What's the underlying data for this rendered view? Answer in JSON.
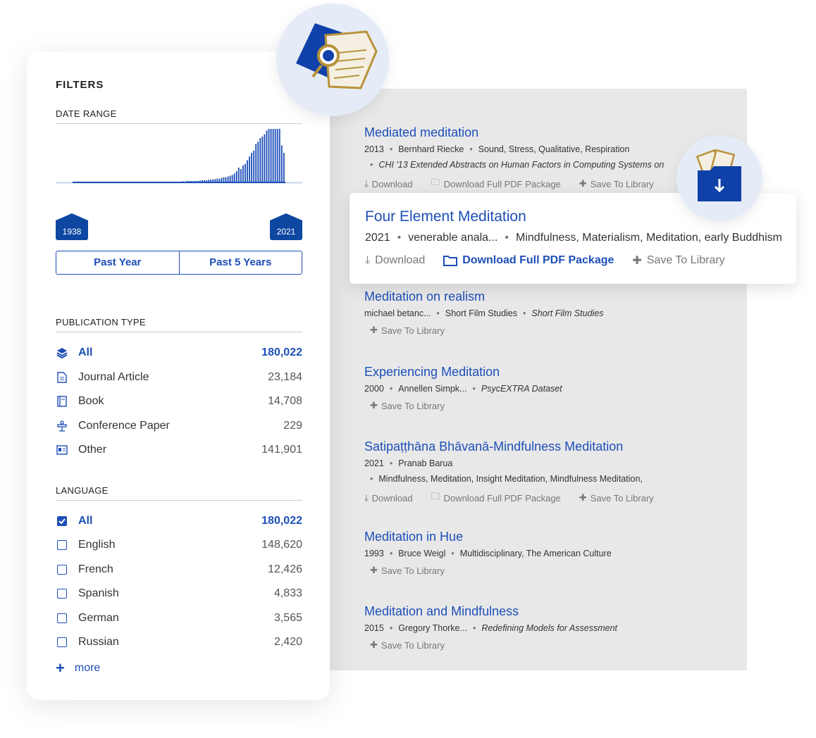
{
  "filters": {
    "heading": "FILTERS",
    "date_range": {
      "label": "DATE RANGE",
      "start_year": "1938",
      "end_year": "2021",
      "past_year": "Past Year",
      "past_5_years": "Past 5 Years"
    },
    "publication_type": {
      "label": "PUBLICATION TYPE",
      "items": [
        {
          "label": "All",
          "count": "180,022",
          "icon": "layers-icon",
          "active": true
        },
        {
          "label": "Journal Article",
          "count": "23,184",
          "icon": "document-icon"
        },
        {
          "label": "Book",
          "count": "14,708",
          "icon": "book-icon"
        },
        {
          "label": "Conference Paper",
          "count": "229",
          "icon": "podium-icon"
        },
        {
          "label": "Other",
          "count": "141,901",
          "icon": "newspaper-icon"
        }
      ]
    },
    "language": {
      "label": "LANGUAGE",
      "items": [
        {
          "label": "All",
          "count": "180,022",
          "checked": true
        },
        {
          "label": "English",
          "count": "148,620",
          "checked": false
        },
        {
          "label": "French",
          "count": "12,426",
          "checked": false
        },
        {
          "label": "Spanish",
          "count": "4,833",
          "checked": false
        },
        {
          "label": "German",
          "count": "3,565",
          "checked": false
        },
        {
          "label": "Russian",
          "count": "2,420",
          "checked": false
        }
      ],
      "more_label": "more"
    }
  },
  "results": [
    {
      "title": "Mediated meditation",
      "meta": [
        "2013",
        "Bernhard Riecke",
        "Sound, Stress, Qualitative, Respiration"
      ],
      "venue": "CHI '13 Extended Abstracts on Human Factors in Computing Systems on",
      "actions": {
        "download": "Download",
        "package": "Download Full PDF Package",
        "save": "Save To Library"
      }
    },
    {
      "title": "Meditation on realism",
      "meta": [
        "michael betanc...",
        "Short Film Studies"
      ],
      "venue_inline": "Short Film Studies",
      "actions": {
        "save": "Save To Library"
      }
    },
    {
      "title": "Experiencing Meditation",
      "meta": [
        "2000",
        "Annellen Simpk..."
      ],
      "venue_inline": "PsycEXTRA Dataset",
      "actions": {
        "save": "Save To Library"
      }
    },
    {
      "title": "Satipaṭṭhāna Bhāvanā-Mindfulness Meditation",
      "meta": [
        "2021",
        "Pranab Barua"
      ],
      "keywords": "Mindfulness, Meditation, Insight Meditation, Mindfulness Meditation,",
      "actions": {
        "download": "Download",
        "package": "Download Full PDF Package",
        "save": "Save To Library"
      }
    },
    {
      "title": "Meditation in Hue",
      "meta": [
        "1993",
        "Bruce Weigl",
        "Multidisciplinary, The American Culture"
      ],
      "actions": {
        "save": "Save To Library"
      }
    },
    {
      "title": "Meditation and Mindfulness",
      "meta": [
        "2015",
        "Gregory Thorke..."
      ],
      "venue_inline": "Redefining Models for Assessment",
      "actions": {
        "save": "Save To Library"
      }
    }
  ],
  "featured": {
    "title": "Four Element Meditation",
    "meta": [
      "2021",
      "venerable anala...",
      "Mindfulness, Materialism, Meditation, early Buddhism"
    ],
    "actions": {
      "download": "Download",
      "package": "Download Full PDF Package",
      "save": "Save To Library"
    }
  },
  "histogram": {
    "values": [
      0.01,
      0.01,
      0.01,
      0.01,
      0.01,
      0.01,
      0.01,
      0.01,
      0.01,
      0.01,
      0.01,
      0.01,
      0.01,
      0.01,
      0.01,
      0.01,
      0.01,
      0.01,
      0.01,
      0.01,
      0.01,
      0.01,
      0.01,
      0.01,
      0.01,
      0.01,
      0.01,
      0.01,
      0.01,
      0.01,
      0.01,
      0.01,
      0.01,
      0.01,
      0.01,
      0.01,
      0.01,
      0.01,
      0.01,
      0.01,
      0.01,
      0.01,
      0.01,
      0.01,
      0.01,
      0.01,
      0.01,
      0.01,
      0.01,
      0.01,
      0.01,
      0.015,
      0.01,
      0.02,
      0.02,
      0.02,
      0.02,
      0.02,
      0.02,
      0.025,
      0.03,
      0.03,
      0.03,
      0.035,
      0.04,
      0.04,
      0.045,
      0.05,
      0.05,
      0.06,
      0.07,
      0.07,
      0.08,
      0.09,
      0.1,
      0.12,
      0.15,
      0.2,
      0.18,
      0.23,
      0.25,
      0.3,
      0.35,
      0.4,
      0.43,
      0.52,
      0.55,
      0.6,
      0.62,
      0.65,
      0.7,
      0.8,
      0.86,
      0.84,
      0.82,
      1.0,
      0.95,
      0.5,
      0.4
    ]
  },
  "colors": {
    "accent": "#1d4fb8",
    "chip": "#0d47a1",
    "panel_bg": "#e8e8e8",
    "icon_gold": "#b8933a"
  }
}
